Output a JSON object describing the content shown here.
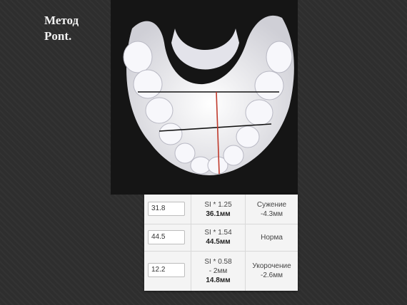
{
  "title": {
    "line1": "Метод",
    "line2": "Pont."
  },
  "table": {
    "rows": [
      {
        "input": "31.8",
        "formula": "SI * 1.25",
        "result": "36.1мм",
        "verdict1": "Сужение",
        "verdict2": "-4.3мм"
      },
      {
        "input": "44.5",
        "formula": "SI * 1.54",
        "result": "44.5мм",
        "verdict1": "Норма",
        "verdict2": ""
      },
      {
        "input": "12.2",
        "formula": "SI * 0.58",
        "formula2": "- 2мм",
        "result": "14.8мм",
        "verdict1": "Укорочение",
        "verdict2": "-2.6мм"
      }
    ]
  },
  "colors": {
    "background": "#2e2e2e",
    "measure_line_black": "#111111",
    "measure_line_red": "#c0392b"
  }
}
